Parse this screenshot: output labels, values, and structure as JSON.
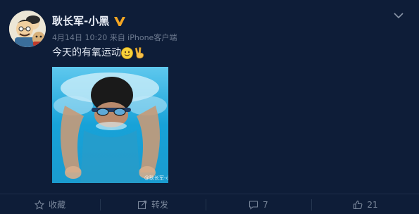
{
  "post": {
    "user": {
      "name": "耿长军-小黑",
      "avatar_icon": "avatar-cartoon-icon",
      "verified_icon": "verified-v-badge-icon",
      "verified_color": "#f5a623"
    },
    "meta": "4月14日 10:20 来自 iPhone客户端",
    "text": "今天的有氧运动",
    "emojis": [
      "smile-emoji-icon",
      "victory-hand-emoji-icon"
    ],
    "photo": {
      "watermark": "@耿长军-小黑",
      "description_icon": "swimmer-photo"
    }
  },
  "actions": {
    "favorite": {
      "label": "收藏",
      "icon": "star-icon"
    },
    "repost": {
      "label": "转发",
      "icon": "repost-icon"
    },
    "comment": {
      "count": "7",
      "icon": "comment-icon"
    },
    "like": {
      "count": "21",
      "icon": "thumbs-up-icon"
    }
  },
  "colors": {
    "background": "#0e1d38",
    "text_primary": "#e9eef7",
    "text_muted": "#6d7a8f",
    "accent_water": "#19a3d6"
  }
}
